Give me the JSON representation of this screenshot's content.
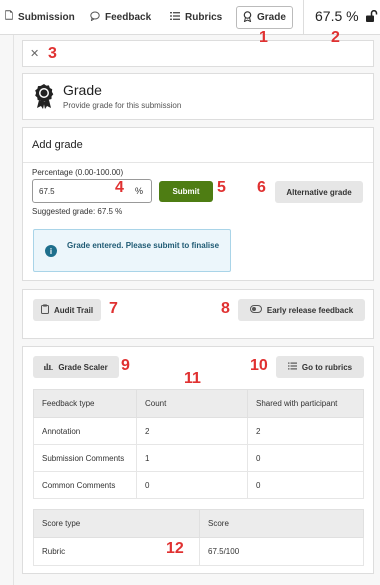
{
  "topbar": {
    "tabs": [
      {
        "label": "Submission",
        "icon": "document-icon"
      },
      {
        "label": "Feedback",
        "icon": "speech-bubble-icon"
      },
      {
        "label": "Rubrics",
        "icon": "list-icon"
      },
      {
        "label": "Grade",
        "icon": "award-icon",
        "active": true
      }
    ],
    "grade_total": "67.5 %",
    "lock_icon": "unlock-icon"
  },
  "annotations": [
    "1",
    "2",
    "3",
    "4",
    "5",
    "6",
    "7",
    "8",
    "9",
    "10",
    "11",
    "12"
  ],
  "header": {
    "title": "Grade",
    "subtitle": "Provide grade for this submission"
  },
  "grade_form": {
    "heading": "Add grade",
    "percentage_label": "Percentage (0.00-100.00)",
    "percentage_value": "67.5",
    "percentage_unit": "%",
    "submit_label": "Submit",
    "alternative_label": "Alternative grade",
    "suggested": "Suggested grade: 67.5 %",
    "alert_text": "Grade entered. Please submit to finalise"
  },
  "actions": {
    "audit_label": "Audit Trail",
    "early_release_label": "Early release feedback"
  },
  "stats": {
    "scaler_label": "Grade Scaler",
    "rubrics_label": "Go to rubrics",
    "feedback_table": {
      "headers": [
        "Feedback type",
        "Count",
        "Shared with participant"
      ],
      "rows": [
        [
          "Annotation",
          "2",
          "2"
        ],
        [
          "Submission Comments",
          "1",
          "0"
        ],
        [
          "Common Comments",
          "0",
          "0"
        ]
      ]
    },
    "score_table": {
      "headers": [
        "Score type",
        "Score"
      ],
      "rows": [
        [
          "Rubric",
          "67.5/100"
        ]
      ]
    }
  },
  "colors": {
    "submit": "#4e7d13",
    "annotation_red": "#e03131",
    "alert_bg": "#ecf6fb"
  }
}
